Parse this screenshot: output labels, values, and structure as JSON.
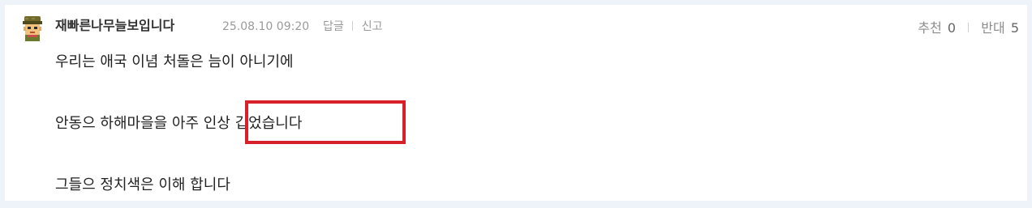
{
  "comment": {
    "author": "재빠른나무늘보입니다",
    "date": "25.08.10 09:20",
    "actions": {
      "reply": "답글",
      "report": "신고"
    },
    "votes": {
      "up_label": "추천",
      "up_count": "0",
      "down_label": "반대",
      "down_count": "5"
    },
    "lines": [
      "우리는 애국 이념 처돌은 늠이 아니기에",
      "안동으 하해마을을 아주 인상 깁었습니다",
      "그들으 정치색은 이해 합니다"
    ]
  },
  "colors": {
    "page_bg": "#eef2f9",
    "card_bg": "#ffffff",
    "highlight": "#d8202a"
  },
  "icons": {
    "avatar": "soldier-avatar-icon"
  }
}
